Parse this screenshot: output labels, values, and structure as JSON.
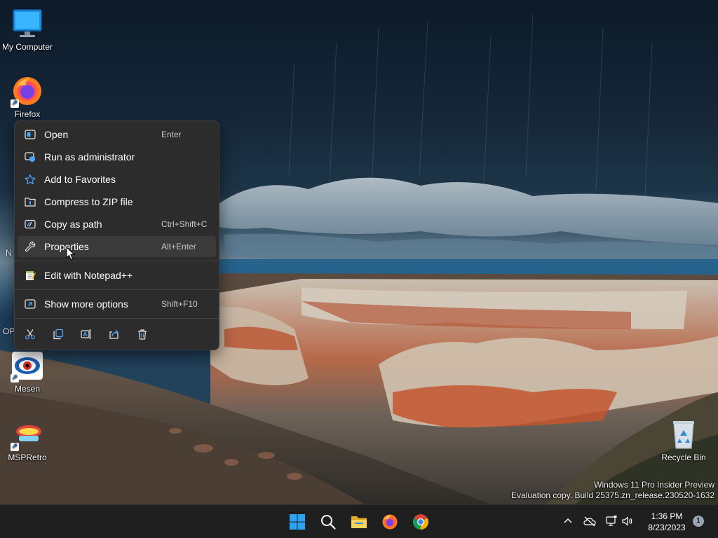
{
  "desktop": {
    "icons": [
      {
        "label": "My Computer"
      },
      {
        "label": "Firefox"
      },
      {
        "label": "Mesen"
      },
      {
        "label": "MSPRetro"
      },
      {
        "label": "Recycle Bin"
      }
    ],
    "partial_labels": [
      "N",
      "OP"
    ]
  },
  "context_menu": {
    "items": [
      {
        "label": "Open",
        "shortcut": "Enter",
        "icon": "open-icon"
      },
      {
        "label": "Run as administrator",
        "shortcut": "",
        "icon": "shield-icon"
      },
      {
        "label": "Add to Favorites",
        "shortcut": "",
        "icon": "star-icon"
      },
      {
        "label": "Compress to ZIP file",
        "shortcut": "",
        "icon": "zip-icon"
      },
      {
        "label": "Copy as path",
        "shortcut": "Ctrl+Shift+C",
        "icon": "path-icon"
      },
      {
        "label": "Properties",
        "shortcut": "Alt+Enter",
        "icon": "wrench-icon"
      },
      {
        "label": "Edit with Notepad++",
        "shortcut": "",
        "icon": "notepad-icon"
      },
      {
        "label": "Show more options",
        "shortcut": "Shift+F10",
        "icon": "more-options-icon"
      }
    ],
    "quick_actions": [
      "cut-icon",
      "copy-icon",
      "rename-icon",
      "share-icon",
      "delete-icon"
    ]
  },
  "watermark": {
    "line1": "Windows 11 Pro Insider Preview",
    "line2": "Evaluation copy. Build 25375.zn_release.230520-1632"
  },
  "taskbar": {
    "apps": [
      "start-icon",
      "search-icon",
      "file-explorer-icon",
      "firefox-icon",
      "chrome-icon"
    ],
    "clock": {
      "time": "1:36 PM",
      "date": "8/23/2023"
    },
    "notification_count": "1"
  },
  "colors": {
    "menu_bg": "#2c2c2c",
    "menu_hover": "#3a3a3a",
    "taskbar_bg": "#1f1f1f",
    "accent": "#0078d4"
  }
}
